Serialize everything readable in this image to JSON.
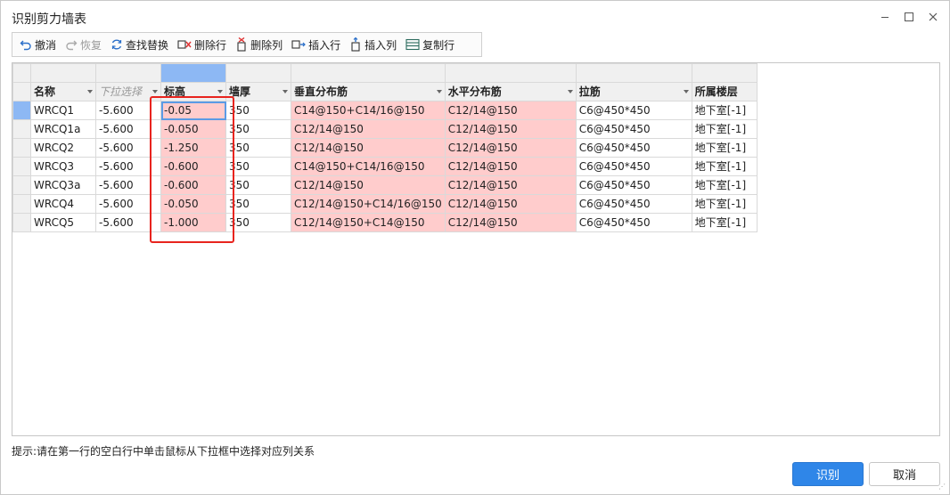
{
  "window": {
    "title": "识别剪力墙表"
  },
  "toolbar": {
    "undo": "撤消",
    "redo": "恢复",
    "find_replace": "查找替换",
    "delete_row": "删除行",
    "delete_col": "删除列",
    "insert_row": "插入行",
    "insert_col": "插入列",
    "copy_row": "复制行"
  },
  "table": {
    "mapping": [
      "名称",
      "下拉选择",
      "标高",
      "墙厚",
      "垂直分布筋",
      "水平分布筋",
      "拉筋",
      "所属楼层"
    ],
    "rows": [
      [
        "WRCQ1",
        "-5.600",
        "-0.05",
        "350",
        "C14@150+C14/16@150",
        "C12/14@150",
        "C6@450*450",
        "地下室[-1]"
      ],
      [
        "WRCQ1a",
        "-5.600",
        "-0.050",
        "350",
        "C12/14@150",
        "C12/14@150",
        "C6@450*450",
        "地下室[-1]"
      ],
      [
        "WRCQ2",
        "-5.600",
        "-1.250",
        "350",
        "C12/14@150",
        "C12/14@150",
        "C6@450*450",
        "地下室[-1]"
      ],
      [
        "WRCQ3",
        "-5.600",
        "-0.600",
        "350",
        "C14@150+C14/16@150",
        "C12/14@150",
        "C6@450*450",
        "地下室[-1]"
      ],
      [
        "WRCQ3a",
        "-5.600",
        "-0.600",
        "350",
        "C12/14@150",
        "C12/14@150",
        "C6@450*450",
        "地下室[-1]"
      ],
      [
        "WRCQ4",
        "-5.600",
        "-0.050",
        "350",
        "C12/14@150+C14/16@150",
        "C12/14@150",
        "C6@450*450",
        "地下室[-1]"
      ],
      [
        "WRCQ5",
        "-5.600",
        "-1.000",
        "350",
        "C12/14@150+C14@150",
        "C12/14@150",
        "C6@450*450",
        "地下室[-1]"
      ]
    ]
  },
  "hint": "提示:请在第一行的空白行中单击鼠标从下拉框中选择对应列关系",
  "buttons": {
    "ok": "识别",
    "cancel": "取消"
  },
  "colors": {
    "accent": "#2f86e8",
    "highlight": "#ffcccc",
    "selection": "#8db8f4",
    "annotation": "#e8241e"
  }
}
